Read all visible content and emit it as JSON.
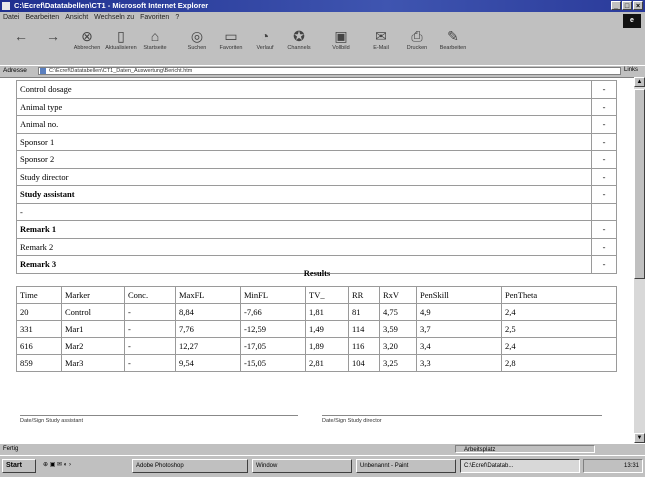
{
  "window": {
    "title": "C:\\Ecref\\Datatabellen\\CT1 - Microsoft Internet Explorer"
  },
  "menu": [
    "Datei",
    "Bearbeiten",
    "Ansicht",
    "Wechseln zu",
    "Favoriten",
    "?"
  ],
  "toolbar": [
    {
      "label": "Abbrechen",
      "icon": "stop-icon"
    },
    {
      "label": "Aktualisieren",
      "icon": "refresh-icon"
    },
    {
      "label": "Startseite",
      "icon": "home-icon"
    },
    {
      "label": "Suchen",
      "icon": "search-icon"
    },
    {
      "label": "Favoriten",
      "icon": "favorites-icon"
    },
    {
      "label": "Verlauf",
      "icon": "history-icon"
    },
    {
      "label": "Channels",
      "icon": "channels-icon"
    },
    {
      "label": "Vollbild",
      "icon": "fullscreen-icon"
    },
    {
      "label": "E-Mail",
      "icon": "mail-icon"
    },
    {
      "label": "Drucken",
      "icon": "print-icon"
    },
    {
      "label": "Bearbeiten",
      "icon": "edit-icon"
    }
  ],
  "address": {
    "label": "Adresse",
    "value": "C:\\Ecref\\Datatabellen\\CT1_Daten_Auswertung\\Bericht.htm",
    "go": "Links"
  },
  "info_rows": [
    {
      "label": "Control dosage",
      "value": "-",
      "bold": false
    },
    {
      "label": "Animal type",
      "value": "-",
      "bold": false
    },
    {
      "label": "Animal no.",
      "value": "-",
      "bold": false
    },
    {
      "label": "Sponsor 1",
      "value": "-",
      "bold": false
    },
    {
      "label": "Sponsor 2",
      "value": "-",
      "bold": false
    },
    {
      "label": "Study director",
      "value": "-",
      "bold": false
    },
    {
      "label": "Study assistant",
      "value": "-",
      "bold": true
    },
    {
      "label": "-",
      "value": "",
      "bold": false
    },
    {
      "label": "Remark 1",
      "value": "-",
      "bold": true
    },
    {
      "label": "Remark 2",
      "value": "-",
      "bold": false
    },
    {
      "label": "Remark 3",
      "value": "-",
      "bold": true
    }
  ],
  "results": {
    "title": "Results",
    "headers": [
      "Time",
      "Marker",
      "Conc.",
      "MaxFL",
      "MinFL",
      "TV_",
      "RR",
      "RxV",
      "PenSkill",
      "PenTheta"
    ],
    "rows": [
      [
        "20",
        "Control",
        "-",
        "8,84",
        "-7,66",
        "1,81",
        "81",
        "4,75",
        "4,9",
        "2,4"
      ],
      [
        "331",
        "Mar1",
        "-",
        "7,76",
        "-12,59",
        "1,49",
        "114",
        "3,59",
        "3,7",
        "2,5"
      ],
      [
        "616",
        "Mar2",
        "-",
        "12,27",
        "-17,05",
        "1,89",
        "116",
        "3,20",
        "3,4",
        "2,4"
      ],
      [
        "859",
        "Mar3",
        "-",
        "9,54",
        "-15,05",
        "2,81",
        "104",
        "3,25",
        "3,3",
        "2,8"
      ]
    ]
  },
  "signatures": [
    "Date/Sign Study assistant",
    "Date/Sign Study director"
  ],
  "status": {
    "left": "Fertig",
    "right": "Arbeitsplatz"
  },
  "taskbar": {
    "start": "Start",
    "items": [
      "Adobe Photoshop",
      "Window",
      "Unbenannt - Paint",
      "C:\\Ecref\\Datatab..."
    ],
    "clock": "13:31"
  }
}
